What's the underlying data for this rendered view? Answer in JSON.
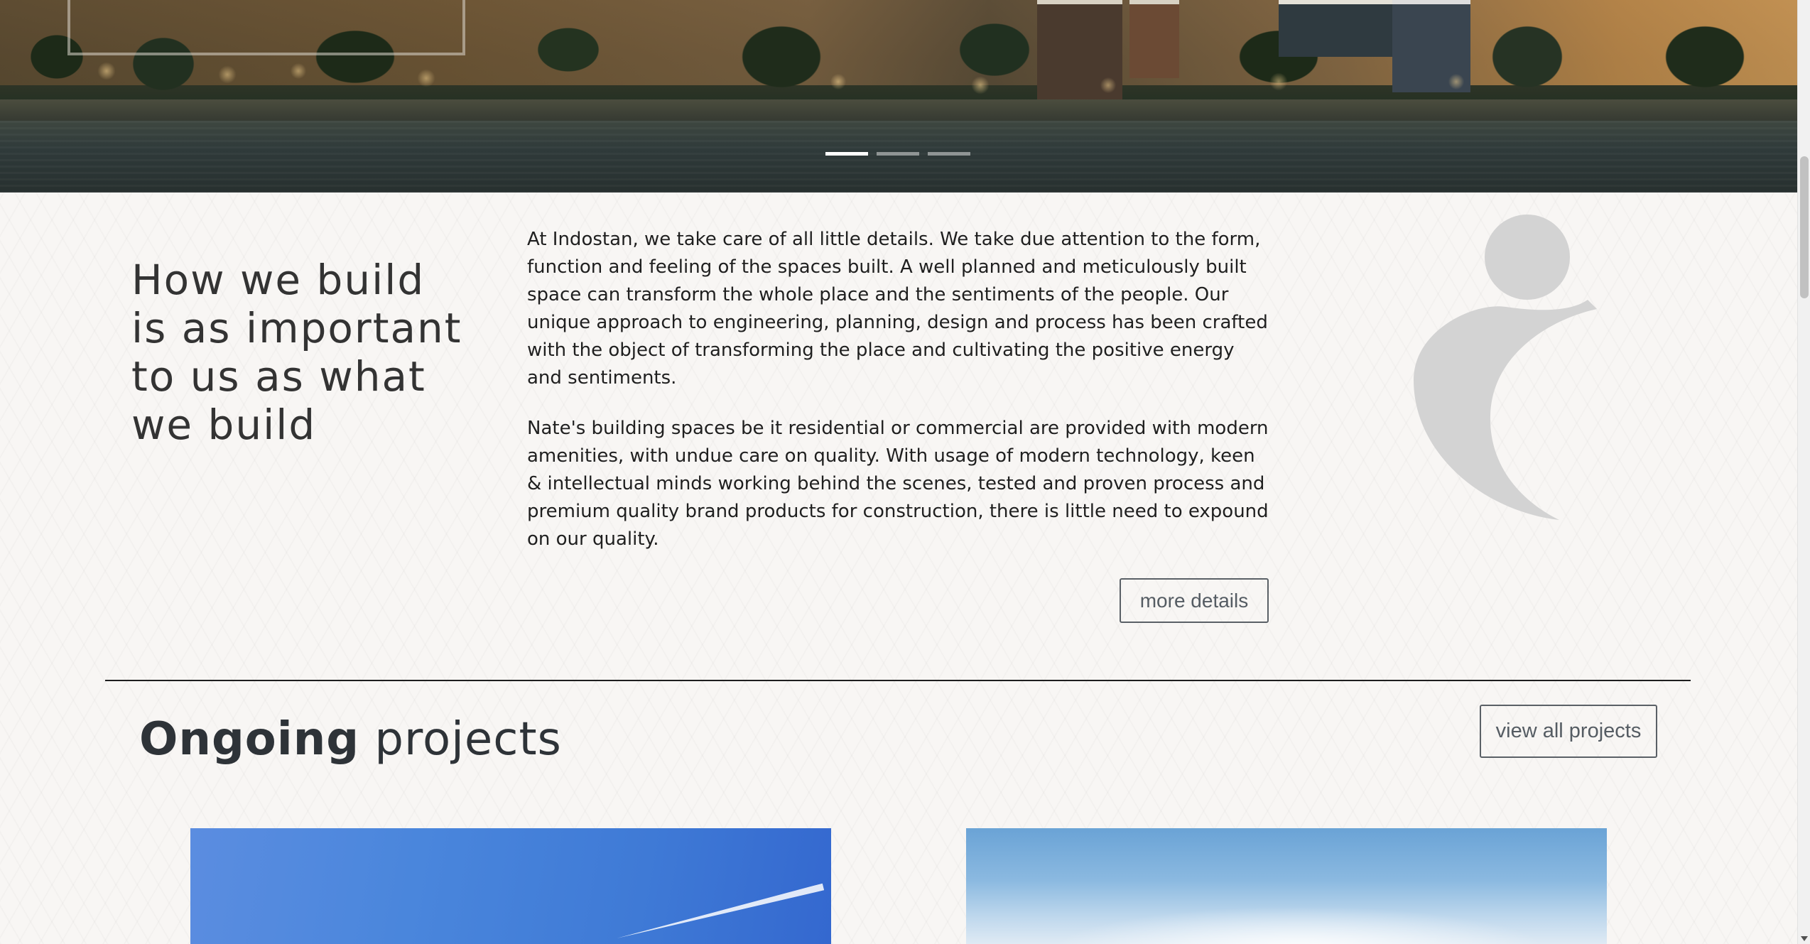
{
  "hero": {
    "slides": [
      {
        "label": "Slide 1",
        "active": true
      },
      {
        "label": "Slide 2",
        "active": false
      },
      {
        "label": "Slide 3",
        "active": false
      }
    ]
  },
  "about": {
    "headline_lines": [
      "How we build",
      "is as important",
      "to us as what",
      "we build"
    ],
    "paragraph_1": "At Indostan, we take care of all little details. We take due attention to the form, function and feeling of the spaces built. A well planned and meticulously built space can transform the whole place and the sentiments of the people. Our unique approach to engineering, planning, design and process has been crafted with the object of transforming the place and cultivating the positive energy and sentiments.",
    "paragraph_2": "Nate's building spaces be it residential or commercial are provided with modern amenities, with undue care on quality. With usage of modern technology, keen & intellectual minds working behind the scenes, tested and proven process and premium quality brand products for construction, there is little need to expound on our quality.",
    "more_button": "more details",
    "logo_icon": "brand-i-logo",
    "logo_color": "#d3d3d3"
  },
  "projects": {
    "title_bold": "Ongoing",
    "title_light": "projects",
    "view_all_button": "view all projects"
  },
  "colors": {
    "text_dark": "#333333",
    "button_border": "#5a6066",
    "divider": "#1e1e1e"
  }
}
